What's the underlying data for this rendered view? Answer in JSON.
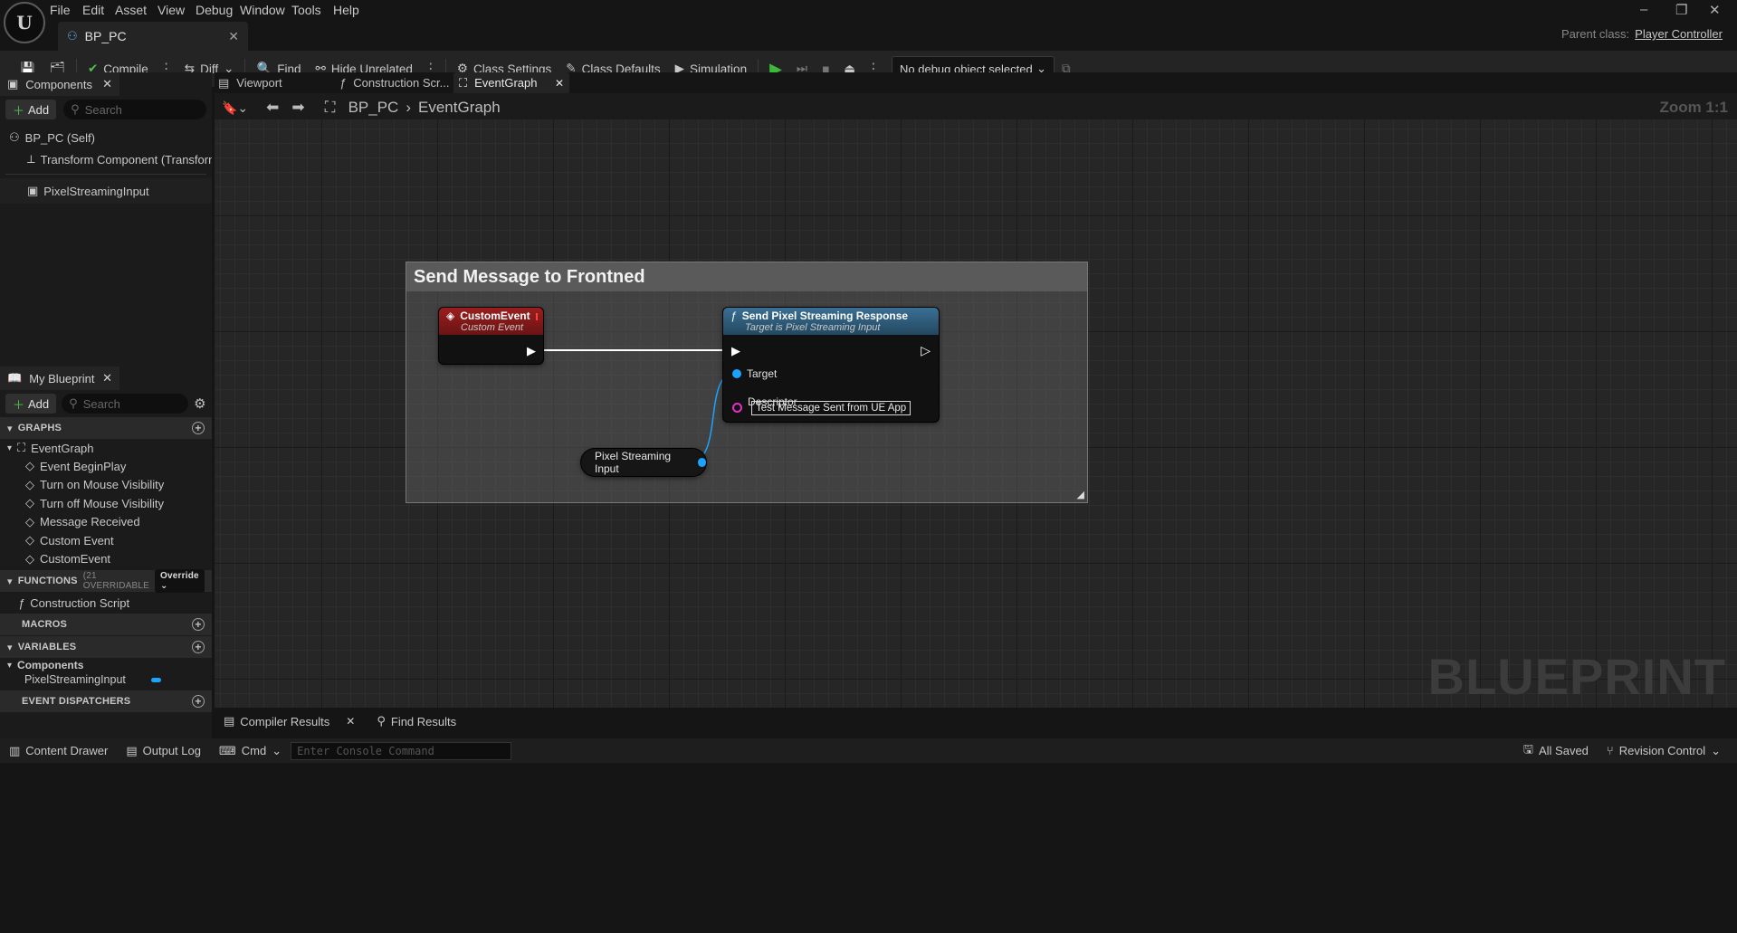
{
  "menu": [
    "File",
    "Edit",
    "Asset",
    "View",
    "Debug",
    "Window",
    "Tools",
    "Help"
  ],
  "doc_tab": {
    "label": "BP_PC"
  },
  "parent_class": {
    "label": "Parent class:",
    "value": "Player Controller"
  },
  "toolbar": {
    "compile": "Compile",
    "diff": "Diff",
    "find": "Find",
    "hide_unrelated": "Hide Unrelated",
    "class_settings": "Class Settings",
    "class_defaults": "Class Defaults",
    "simulation": "Simulation",
    "debug_object": "No debug object selected"
  },
  "components_panel": {
    "title": "Components",
    "add": "Add",
    "search_placeholder": "Search",
    "items": [
      "BP_PC (Self)",
      "Transform Component (TransformCom",
      "PixelStreamingInput"
    ]
  },
  "my_blueprint": {
    "title": "My Blueprint",
    "add": "Add",
    "search_placeholder": "Search",
    "graphs_label": "GRAPHS",
    "event_graph": "EventGraph",
    "events": [
      "Event BeginPlay",
      "Turn on Mouse Visibility",
      "Turn off Mouse Visibility",
      "Message Received",
      "Custom Event",
      "CustomEvent"
    ],
    "functions_label": "FUNCTIONS",
    "functions_count": "(21 OVERRIDABLE",
    "override": "Override",
    "construction_script": "Construction Script",
    "macros_label": "MACROS",
    "variables_label": "VARIABLES",
    "components_label": "Components",
    "variable": "PixelStreamingInput",
    "dispatchers_label": "EVENT DISPATCHERS"
  },
  "editor_tabs": {
    "viewport": "Viewport",
    "construction": "Construction Scr...",
    "eventgraph": "EventGraph"
  },
  "breadcrumb": {
    "bp": "BP_PC",
    "graph": "EventGraph",
    "zoom": "Zoom 1:1"
  },
  "comment": {
    "title": "Send Message to Frontned"
  },
  "custom_event_node": {
    "title": "CustomEvent",
    "subtitle": "Custom Event"
  },
  "send_node": {
    "title": "Send Pixel Streaming Response",
    "subtitle": "Target is Pixel Streaming Input",
    "target": "Target",
    "descriptor": "Descriptor",
    "descriptor_value": "Test Message Sent from UE App"
  },
  "var_node": {
    "label": "Pixel Streaming Input"
  },
  "watermark": "BLUEPRINT",
  "bottom_tabs": {
    "compiler": "Compiler Results",
    "find": "Find Results"
  },
  "status": {
    "content_drawer": "Content Drawer",
    "output_log": "Output Log",
    "cmd": "Cmd",
    "console_placeholder": "Enter Console Command",
    "all_saved": "All Saved",
    "revision": "Revision Control"
  },
  "colors": {
    "event_header": "#8c1c1c",
    "function_header": "#2d5a78",
    "object_pin": "#1aa3ff",
    "string_pin": "#e030c8"
  }
}
